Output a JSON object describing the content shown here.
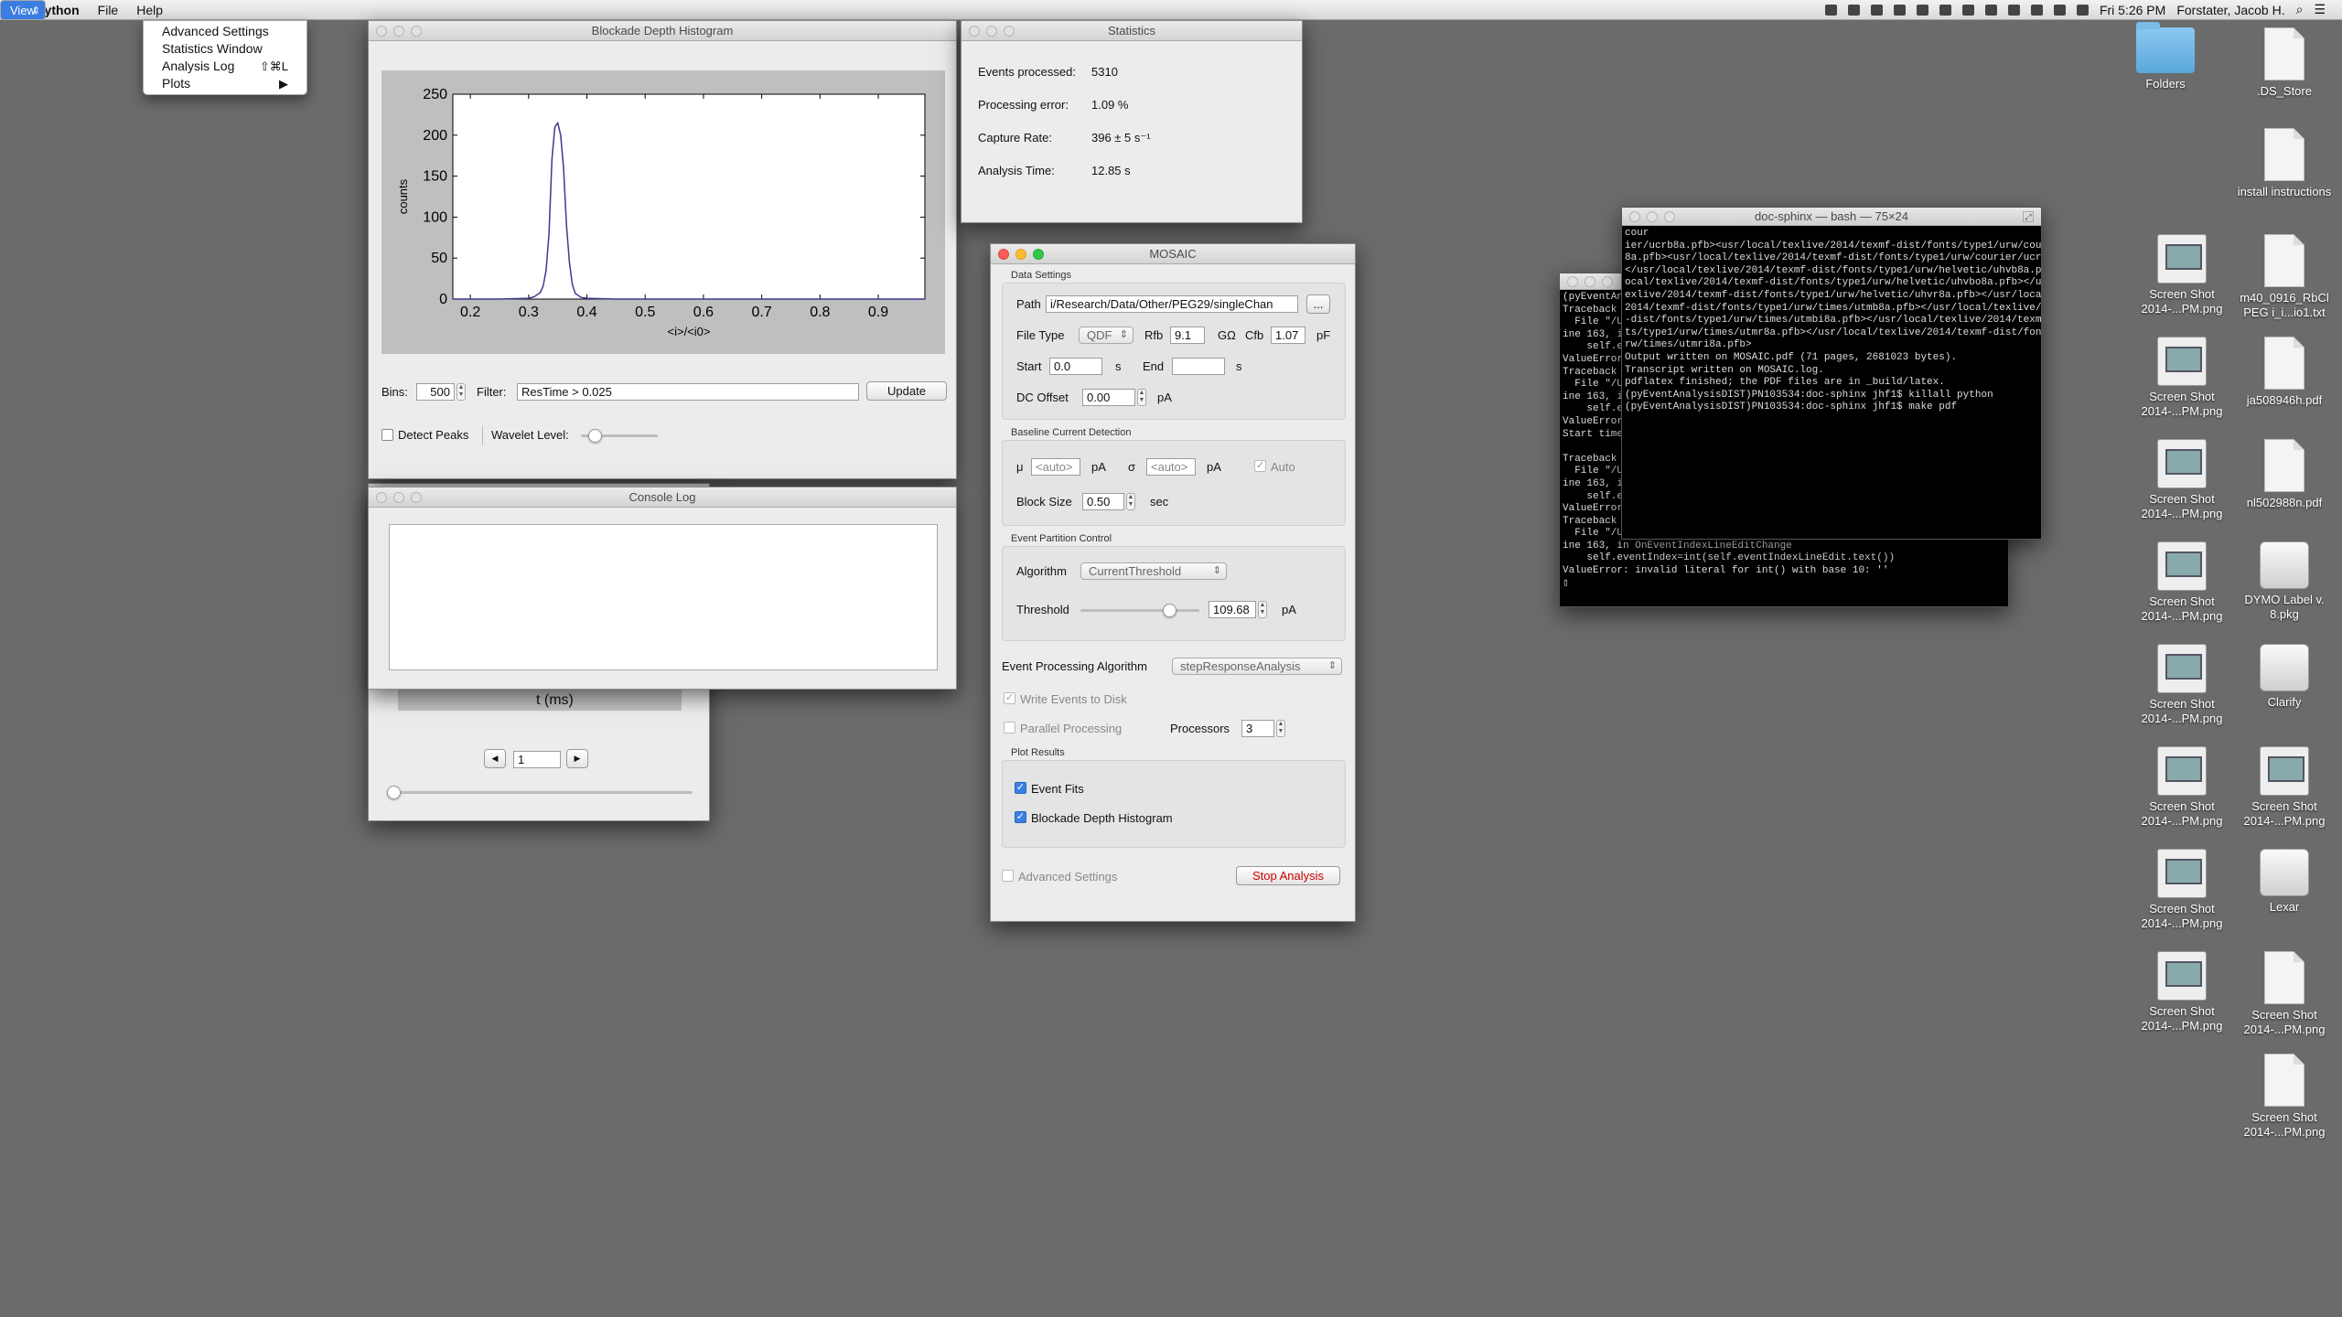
{
  "menubar": {
    "apple": "",
    "app": "python",
    "items": [
      "File",
      "View",
      "Help"
    ],
    "clock": "Fri 5:26 PM",
    "user": "Forstater, Jacob H."
  },
  "view_menu": [
    {
      "label": "Advanced Settings",
      "shortcut": ""
    },
    {
      "label": "Statistics Window",
      "shortcut": ""
    },
    {
      "label": "Analysis Log",
      "shortcut": "⇧⌘L"
    },
    {
      "label": "Plots",
      "shortcut": "▶"
    }
  ],
  "histogram": {
    "title": "Blockade Depth Histogram",
    "bins_label": "Bins:",
    "bins_value": "500",
    "filter_label": "Filter:",
    "filter_value": "ResTime > 0.025",
    "update": "Update",
    "detect_peaks": "Detect Peaks",
    "wavelet": "Wavelet Level:"
  },
  "chart_data": {
    "type": "line",
    "title": "",
    "xlabel": "<i>/<i0>",
    "ylabel": "counts",
    "xlim": [
      0.17,
      0.98
    ],
    "ylim": [
      0,
      250
    ],
    "xticks": [
      0.2,
      0.3,
      0.4,
      0.5,
      0.6,
      0.7,
      0.8,
      0.9
    ],
    "yticks": [
      0,
      50,
      100,
      150,
      200,
      250
    ],
    "x": [
      0.17,
      0.2,
      0.25,
      0.3,
      0.31,
      0.32,
      0.325,
      0.33,
      0.335,
      0.34,
      0.345,
      0.35,
      0.355,
      0.36,
      0.365,
      0.37,
      0.375,
      0.38,
      0.39,
      0.4,
      0.45,
      0.5,
      0.6,
      0.7,
      0.8,
      0.9,
      0.98
    ],
    "y": [
      0,
      0,
      0,
      1,
      3,
      8,
      16,
      35,
      80,
      170,
      210,
      215,
      200,
      160,
      90,
      45,
      18,
      7,
      2,
      1,
      0,
      0,
      0,
      0,
      0,
      0,
      0
    ]
  },
  "statistics": {
    "title": "Statistics",
    "rows": [
      {
        "label": "Events processed:",
        "value": "5310"
      },
      {
        "label": "Processing error:",
        "value": "1.09 %"
      },
      {
        "label": "Capture Rate:",
        "value": "396 ± 5 s⁻¹"
      },
      {
        "label": "Analysis Time:",
        "value": "12.85 s"
      }
    ]
  },
  "console": {
    "title": "Console Log"
  },
  "eventfit": {
    "xlabel": "t (ms)",
    "index": "1"
  },
  "mosaic": {
    "title": "MOSAIC",
    "data_settings": "Data Settings",
    "path_label": "Path",
    "path_value": "i/Research/Data/Other/PEG29/singleChan",
    "browse": "...",
    "filetype_label": "File Type",
    "filetype_value": "QDF",
    "rfb_label": "Rfb",
    "rfb_value": "9.1",
    "rfb_unit": "GΩ",
    "cfb_label": "Cfb",
    "cfb_value": "1.07",
    "cfb_unit": "pF",
    "start_label": "Start",
    "start_value": "0.0",
    "start_unit": "s",
    "end_label": "End",
    "end_value": "",
    "end_unit": "s",
    "dc_label": "DC Offset",
    "dc_value": "0.00",
    "dc_unit": "pA",
    "baseline": "Baseline Current Detection",
    "mu_label": "μ",
    "mu_value": "<auto>",
    "mu_unit": "pA",
    "sigma_label": "σ",
    "sigma_value": "<auto>",
    "sigma_unit": "pA",
    "auto": "Auto",
    "block_label": "Block Size",
    "block_value": "0.50",
    "block_unit": "sec",
    "partition": "Event Partition Control",
    "algo_label": "Algorithm",
    "algo_value": "CurrentThreshold",
    "thresh_label": "Threshold",
    "thresh_value": "109.68",
    "thresh_unit": "pA",
    "proc_label": "Event Processing Algorithm",
    "proc_value": "stepResponseAnalysis",
    "write_events": "Write Events to Disk",
    "parallel": "Parallel Processing",
    "processors_label": "Processors",
    "processors_value": "3",
    "plot_results": "Plot Results",
    "event_fits": "Event Fits",
    "blockade_hist": "Blockade Depth Histogram",
    "advanced": "Advanced Settings",
    "stop": "Stop Analysis"
  },
  "terminal_front": {
    "title": "doc-sphinx — bash — 75×24",
    "text": "cour\nier/ucrb8a.pfb><usr/local/texlive/2014/texmf-dist/fonts/type1/urw/courier/ucrr\n8a.pfb><usr/local/texlive/2014/texmf-dist/fonts/type1/urw/courier/ucrro8a.pfb>\n</usr/local/texlive/2014/texmf-dist/fonts/type1/urw/helvetic/uhvb8a.pfb></usr/l\nocal/texlive/2014/texmf-dist/fonts/type1/urw/helvetic/uhvbo8a.pfb></usr/local/t\nexlive/2014/texmf-dist/fonts/type1/urw/helvetic/uhvr8a.pfb></usr/local/texlive/\n2014/texmf-dist/fonts/type1/urw/times/utmb8a.pfb></usr/local/texlive/2014/texmf\n-dist/fonts/type1/urw/times/utmbi8a.pfb></usr/local/texlive/2014/texmf-dist/fon\nts/type1/urw/times/utmr8a.pfb></usr/local/texlive/2014/texmf-dist/fonts/type1/u\nrw/times/utmri8a.pfb>\nOutput written on MOSAIC.pdf (71 pages, 2681023 bytes).\nTranscript written on MOSAIC.log.\npdflatex finished; the PDF files are in _build/latex.\n(pyEventAnalysisDIST)PN103534:doc-sphinx jhf1$ killall python\n(pyEventAnalysisDIST)PN103534:doc-sphinx jhf1$ make pdf"
  },
  "terminal_back": {
    "text": "(pyEventAn\nTraceback (\n  File \"/Us\nine 163, i\n    self.ev\nValueError:\nTraceback (\n  File \"/Us\nine 163, i\n    self.ev\nValueError:\nStart time:\n\nTraceback (\n  File \"/Us\nine 163, i\n    self.ev\nValueError:\nTraceback (most recent call last):\n  File \"/Users/jhf1/Projects/MOSAIC/mosaicgui/fiteventsview/fiteventsview.py\", l\nine 163, in OnEventIndexLineEditChange\n    self.eventIndex=int(self.eventIndexLineEdit.text())\nValueError: invalid literal for int() with base 10: ''\n▯"
  },
  "desktop": [
    {
      "name": "Folders",
      "kind": "folder"
    },
    {
      "name": ".DS_Store",
      "kind": "doc"
    },
    {
      "name": "install instructions",
      "kind": "doc"
    },
    {
      "name": "Screen Shot 2014-...PM.png",
      "kind": "shot"
    },
    {
      "name": "m40_0916_RbCl PEG i_i...io1.txt",
      "kind": "doc"
    },
    {
      "name": "Screen Shot 2014-...PM.png",
      "kind": "shot"
    },
    {
      "name": "ja508946h.pdf",
      "kind": "doc"
    },
    {
      "name": "Screen Shot 2014-...PM.png",
      "kind": "shot"
    },
    {
      "name": "nl502988n.pdf",
      "kind": "doc"
    },
    {
      "name": "Screen Shot 2014-...PM.png",
      "kind": "shot"
    },
    {
      "name": "DYMO Label v. 8.pkg",
      "kind": "drive"
    },
    {
      "name": "Screen Shot 2014-...PM.png",
      "kind": "shot"
    },
    {
      "name": "Clarify",
      "kind": "drive"
    },
    {
      "name": "Screen Shot 2014-...PM.png",
      "kind": "shot"
    },
    {
      "name": "Screen Shot 2014-...PM.png",
      "kind": "shot"
    },
    {
      "name": "Screen Shot 2014-...PM.png",
      "kind": "shot"
    },
    {
      "name": "Lexar",
      "kind": "drive"
    },
    {
      "name": "Screen Shot 2014-...PM.png",
      "kind": "shot"
    },
    {
      "name": "Screen Shot 2014-...PM.png",
      "kind": "doc"
    },
    {
      "name": "Screen Shot 2014-...PM.png",
      "kind": "doc"
    }
  ]
}
